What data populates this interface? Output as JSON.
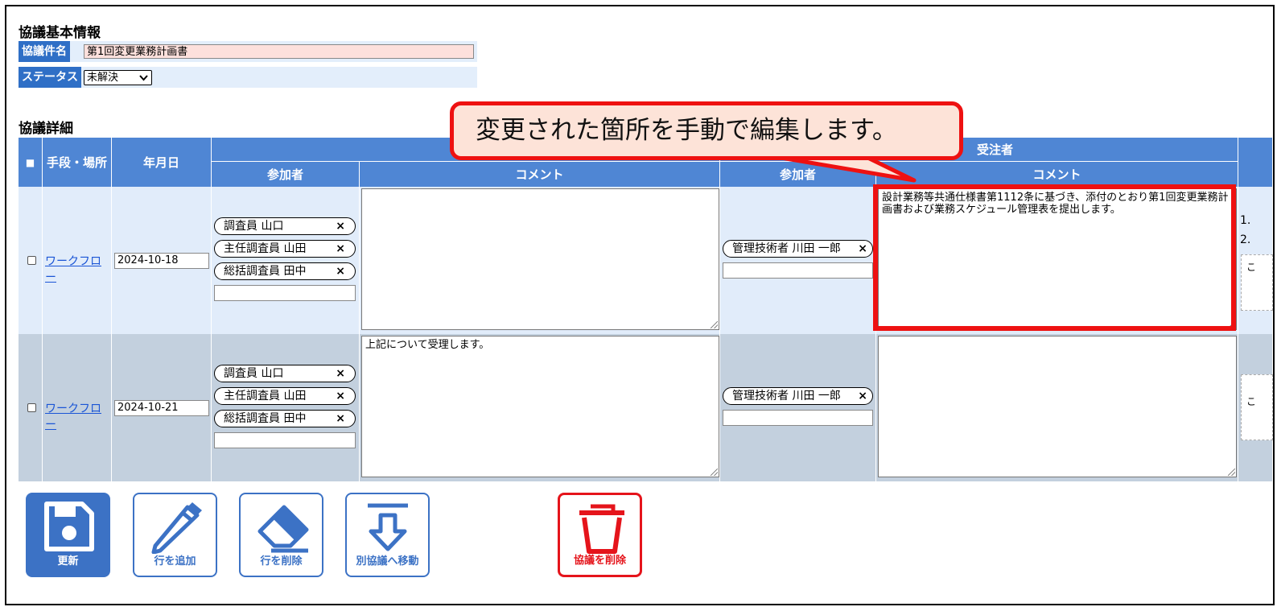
{
  "basic_info": {
    "title": "協議基本情報",
    "subject_label": "協議件名",
    "subject_value": "第1回変更業務計画書",
    "status_label": "ステータス",
    "status_value": "未解決"
  },
  "details": {
    "title": "協議詳細",
    "headers": {
      "select_all": "■",
      "method_place": "手段・場所",
      "date": "年月日",
      "contractor_group": "受注者",
      "participants": "参加者",
      "comment": "コメント"
    },
    "rows": [
      {
        "method_link": "ワークフロー",
        "date": "2024-10-18",
        "client_participants": [
          "調査員 山口",
          "主任調査員 山田",
          "総括調査員 田中"
        ],
        "client_comment": "",
        "contractor_participants": [
          "管理技術者 川田 一郎"
        ],
        "contractor_comment": "設計業務等共通仕様書第1112条に基づき、添付のとおり第1回変更業務計画書および業務スケジュール管理表を提出します。",
        "side_items": [
          "1.",
          "2.",
          "こ"
        ]
      },
      {
        "method_link": "ワークフロー",
        "date": "2024-10-21",
        "client_participants": [
          "調査員 山口",
          "主任調査員 山田",
          "総括調査員 田中"
        ],
        "client_comment": "上記について受理します。",
        "contractor_participants": [
          "管理技術者 川田 一郎"
        ],
        "contractor_comment": "",
        "side_items": [
          "こ"
        ]
      }
    ],
    "remove_glyph": "×"
  },
  "toolbar": {
    "update": "更新",
    "add_row": "行を追加",
    "delete_row": "行を削除",
    "move_to_other": "別協議へ移動",
    "delete_meeting": "協議を削除"
  },
  "callout": {
    "text": "変更された箇所を手動で編集します。"
  },
  "colors": {
    "header_blue": "#4f86d4",
    "label_blue": "#2f6fc6",
    "row1_bg": "#e1ecfa",
    "row2_bg": "#c3d0de",
    "danger_red": "#e5141b",
    "subject_bg": "#fde0dc"
  }
}
